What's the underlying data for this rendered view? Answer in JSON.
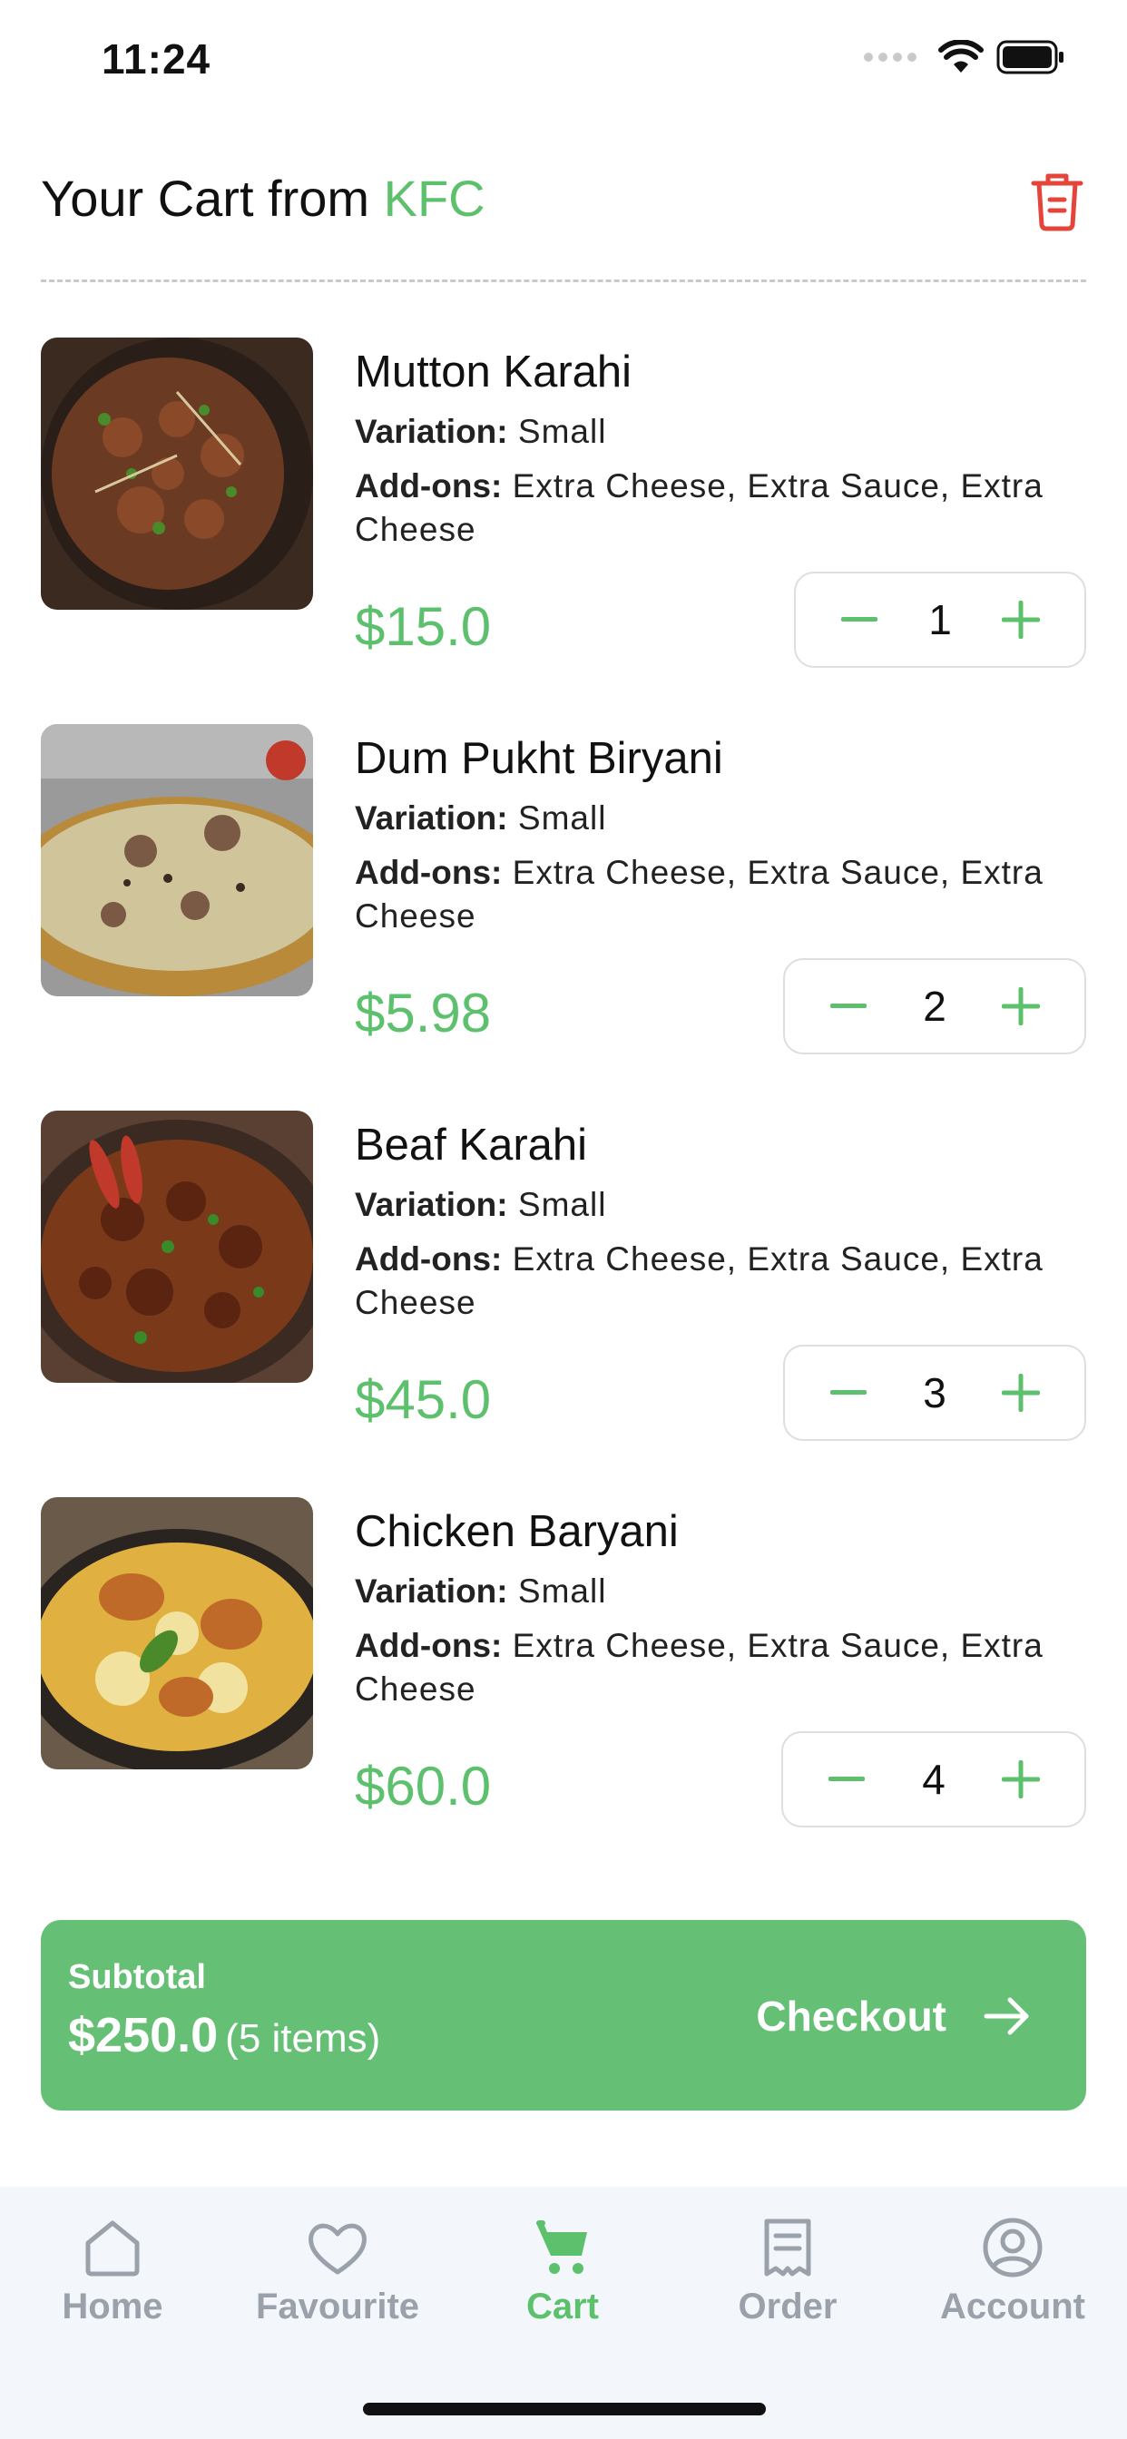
{
  "status_bar": {
    "time": "11:24"
  },
  "header": {
    "title_prefix": "Your Cart from",
    "restaurant": "KFC"
  },
  "cart": {
    "variation_label": "Variation:",
    "addons_label": "Add-ons:",
    "items": [
      {
        "name": "Mutton Karahi",
        "variation": "Small",
        "addons": "Extra Cheese, Extra Sauce, Extra Cheese",
        "price": "$15.0",
        "quantity": "1"
      },
      {
        "name": "Dum Pukht Biryani",
        "variation": "Small",
        "addons": "Extra Cheese, Extra Sauce, Extra Cheese",
        "price": "$5.98",
        "quantity": "2"
      },
      {
        "name": "Beaf Karahi",
        "variation": "Small",
        "addons": "Extra Cheese, Extra Sauce, Extra Cheese",
        "price": "$45.0",
        "quantity": "3"
      },
      {
        "name": "Chicken Baryani",
        "variation": "Small",
        "addons": "Extra Cheese, Extra Sauce, Extra Cheese",
        "price": "$60.0",
        "quantity": "4"
      }
    ]
  },
  "checkout": {
    "subtotal_label": "Subtotal",
    "subtotal_amount": "$250.0",
    "item_count": "(5 items)",
    "button_label": "Checkout"
  },
  "nav": {
    "items": [
      {
        "label": "Home",
        "icon": "home-icon",
        "active": false
      },
      {
        "label": "Favourite",
        "icon": "heart-icon",
        "active": false
      },
      {
        "label": "Cart",
        "icon": "cart-icon",
        "active": true
      },
      {
        "label": "Order",
        "icon": "receipt-icon",
        "active": false
      },
      {
        "label": "Account",
        "icon": "user-icon",
        "active": false
      }
    ]
  },
  "colors": {
    "accent": "#5cc06c",
    "checkout_bg": "#65c075",
    "delete": "#e5443b",
    "nav_inactive": "#9aa1ab",
    "nav_bg": "#f3f6fa"
  }
}
